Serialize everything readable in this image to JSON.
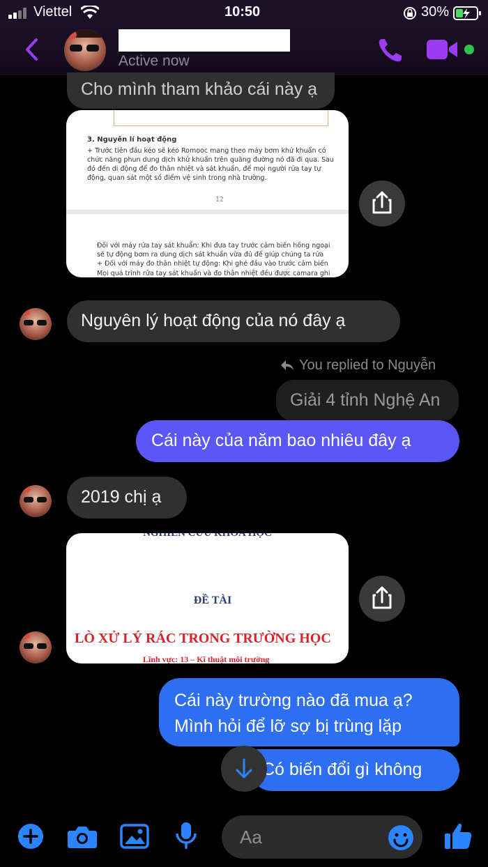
{
  "status_bar": {
    "carrier": "Viettel",
    "time": "10:50",
    "battery": "30%"
  },
  "header": {
    "presence": "Active now"
  },
  "messages": {
    "top_cut": "Cho mình tham khảo cái này ạ",
    "doc1": {
      "heading": "3. Nguyên lí hoạt động",
      "para1": "+ Trước tiên đầu kéo sẽ kéo Romooc mang theo máy bơm khử khuẩn có chức năng phun dung dịch khử khuẩn trên quãng đường nó đã đi qua. Sau đó đến di động để đo thân nhiệt và sát khuẩn, để mọi người rửa tay tự động, quan sát một số điểm vệ sinh trong nhà trường.",
      "page_num": "12",
      "para2": "Đối với máy rửa tay sát khuẩn: Khi đưa tay trước cảm biến hồng ngoại sẽ tự động bơm ra dung dịch sát khuẩn vừa đủ để giúp chúng ta rửa tay sát khuẩn.",
      "para3": "+ Đối với máy đo thân nhiệt tự động: Khi ghé đầu vào trước cảm biến cách từ 3 đến 5 cm, máy đo thân nhiệt sẽ tự động kích hoạt mạch điện ở trong công tác và sẽ tự động đo thân nhiệt.",
      "para4": "Mọi quá trình rửa tay sát khuẩn và đo thân nhiệt đều được camara ghi lại"
    },
    "msg_principle": "Nguyên lý hoạt động của nó đây ạ",
    "reply_note": "You replied to Nguyễn",
    "quoted": "Giải 4 tỉnh Nghệ An",
    "msg_year": "Cái này của năm bao nhiêu đây ạ",
    "msg_2019": "2019 chị ạ",
    "doc2": {
      "top": "NGHIÊN CỨU KHOA HỌC",
      "label": "ĐỀ TÀI",
      "title": "LÒ XỬ LÝ RÁC TRONG TRƯỜNG HỌC",
      "field": "Lĩnh vực: 13 – Kĩ thuật môi trường"
    },
    "msg_which_school": "Cái này trường nào đã mua ạ? Mình hỏi để lỡ sợ bị trùng lặp",
    "msg_change": "Có biến đổi gì không"
  },
  "composer": {
    "placeholder": "Aa"
  },
  "colors": {
    "accent": "#9b3cf3",
    "out_bubble": "#5b57f4",
    "out_bubble_alt": "#2e6ff1",
    "icon_blue": "#2a85ff"
  }
}
